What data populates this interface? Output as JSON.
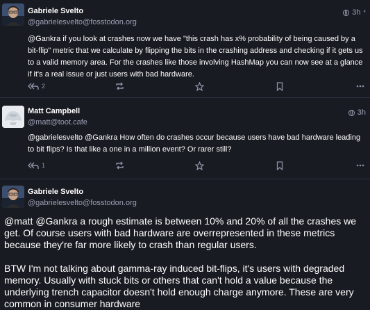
{
  "posts": [
    {
      "author": "Gabriele Svelto",
      "handle": "@gabrielesvelto@fosstodon.org",
      "time": "3h",
      "edited_marker": "*",
      "paragraphs": [
        "@Gankra if you look at crashes now we have \"this crash has x% probability of being caused by a bit-flip\" metric that we calculate by flipping the bits in the crashing address and checking if it gets us to a valid memory area. For the crashes like those involving HashMap you can now see at a glance if it's a real issue or just users with bad hardware."
      ],
      "reply_count": "2",
      "icons": {
        "reply": "reply-all-icon",
        "boost": "boost-icon",
        "favourite": "star-icon",
        "bookmark": "bookmark-icon",
        "more": "more-icon",
        "visibility": "globe-icon"
      }
    },
    {
      "author": "Matt Campbell",
      "handle": "@matt@toot.cafe",
      "time": "3h",
      "paragraphs": [
        "@gabrielesvelto @Gankra How often do crashes occur because users have bad hardware leading to bit flips? Is that like a one in a million event? Or rarer still?"
      ],
      "reply_count": "1",
      "icons": {
        "reply": "reply-all-icon",
        "boost": "boost-icon",
        "favourite": "star-icon",
        "bookmark": "bookmark-icon",
        "more": "more-icon",
        "visibility": "globe-icon"
      }
    },
    {
      "author": "Gabriele Svelto",
      "handle": "@gabrielesvelto@fosstodon.org",
      "paragraphs": [
        "@matt @Gankra a rough estimate is between 10% and 20% of all the crashes we get. Of course users with bad hardware are overrepresented in these metrics because they're far more likely to crash than regular users.",
        "BTW I'm not talking about gamma-ray induced bit-flips, it's users with degraded memory. Usually with stuck bits or others that can't hold a value because the underlying trench capacitor doesn't hold enough charge anymore. These are very common in consumer hardware"
      ]
    }
  ],
  "colors": {
    "background": "#191b22",
    "text": "#ffffff",
    "muted": "#9b9fb4",
    "divider": "#2e3140"
  }
}
